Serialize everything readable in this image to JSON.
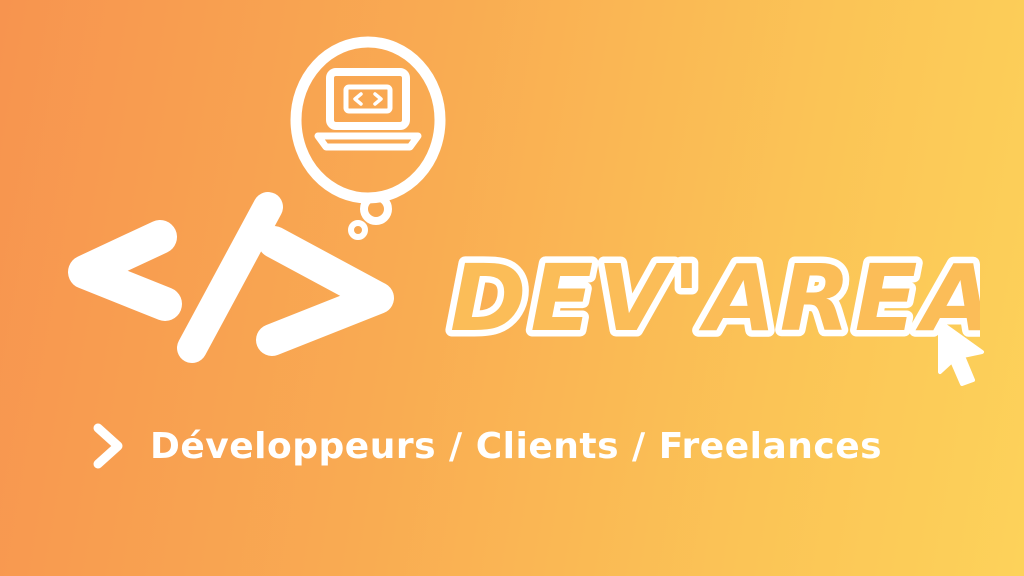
{
  "brand": {
    "name": "DEV'AREA",
    "tagline": "Développeurs / Clients / Freelances"
  },
  "icons": {
    "code_brackets": "code-brackets-icon",
    "thought_bubble": "thought-bubble-icon",
    "laptop": "laptop-code-icon",
    "cursor": "mouse-cursor-icon",
    "tagline_bullet": "chevron-right-icon"
  },
  "colors": {
    "gradient_start": "#f7944f",
    "gradient_end": "#fdd25a",
    "wordmark_fill": "#fbbd58",
    "outline": "#ffffff"
  }
}
